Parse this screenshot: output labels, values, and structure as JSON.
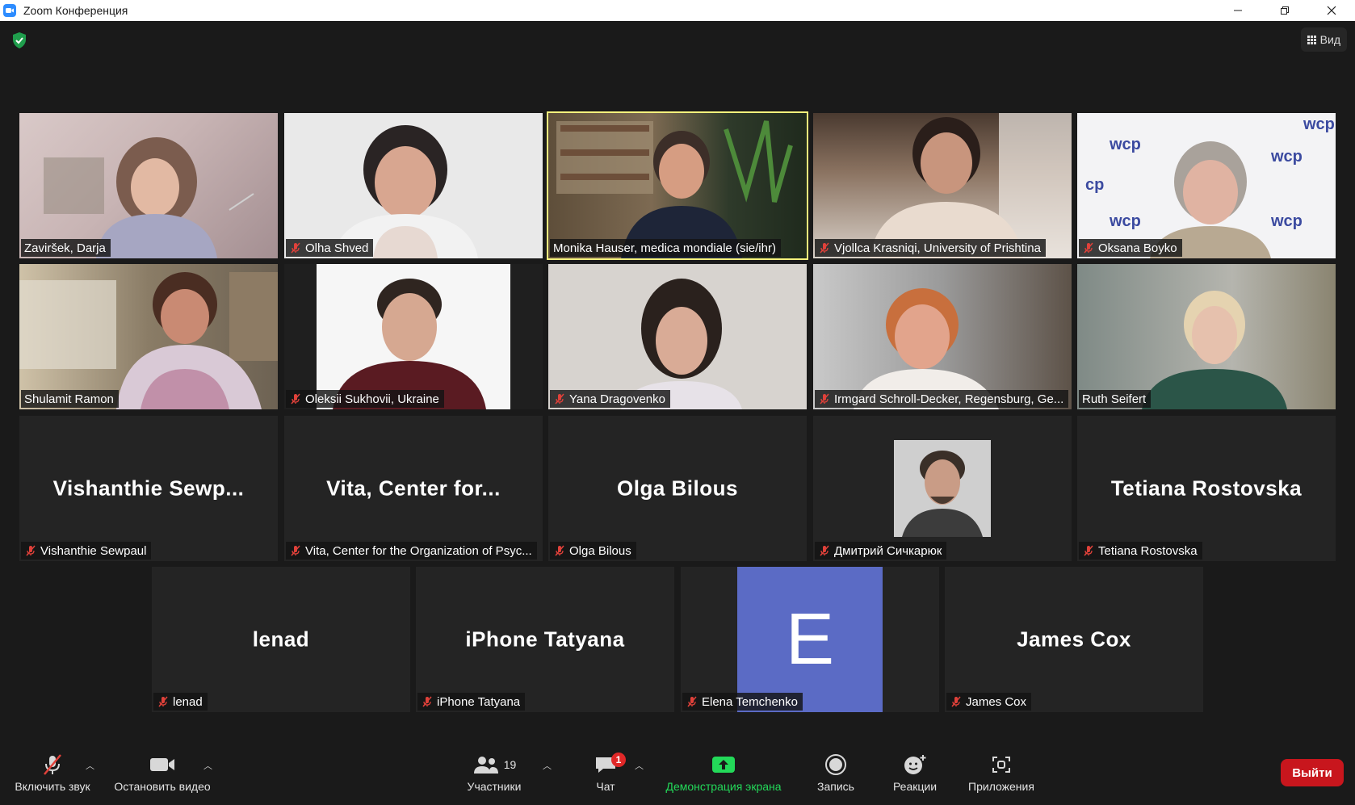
{
  "window": {
    "title": "Zoom Конференция",
    "controls": [
      "minimize",
      "maximize",
      "close"
    ]
  },
  "topbar": {
    "security_icon": "green-shield-check",
    "view_label": "Вид"
  },
  "participants": [
    {
      "name": "Zaviršek, Darja",
      "muted": false,
      "video": true,
      "active": false
    },
    {
      "name": "Olha Shved",
      "muted": true,
      "video": true,
      "active": false
    },
    {
      "name": "Monika Hauser, medica mondiale (sie/ihr)",
      "muted": false,
      "video": true,
      "active": true
    },
    {
      "name": "Vjollca Krasniqi, University of Prishtina",
      "muted": true,
      "video": true,
      "active": false
    },
    {
      "name": "Oksana Boyko",
      "muted": true,
      "video": true,
      "active": false
    },
    {
      "name": "Shulamit Ramon",
      "muted": false,
      "video": true,
      "active": false
    },
    {
      "name": "Oleksii Sukhovii, Ukraine",
      "muted": true,
      "video": true,
      "active": false
    },
    {
      "name": "Yana Dragovenko",
      "muted": true,
      "video": true,
      "active": false
    },
    {
      "name": "Irmgard Schroll-Decker, Regensburg, Ge...",
      "muted": true,
      "video": true,
      "active": false
    },
    {
      "name": "Ruth Seifert",
      "muted": false,
      "video": true,
      "active": false
    },
    {
      "name": "Vishanthie Sewpaul",
      "big": "Vishanthie  Sewp...",
      "muted": true,
      "video": false
    },
    {
      "name": "Vita, Center for the Organization of Psyc...",
      "big": "Vita,  Center  for...",
      "muted": true,
      "video": false
    },
    {
      "name": "Olga Bilous",
      "big": "Olga Bilous",
      "muted": true,
      "video": false
    },
    {
      "name": "Дмитрий Сичкарюк",
      "muted": true,
      "video": false,
      "avatar": true
    },
    {
      "name": "Tetiana Rostovska",
      "big": "Tetiana Rostovska",
      "muted": true,
      "video": false
    },
    {
      "name": "lenad",
      "big": "lenad",
      "muted": true,
      "video": false
    },
    {
      "name": "iPhone Tatyana",
      "big": "iPhone Tatyana",
      "muted": true,
      "video": false
    },
    {
      "name": "Elena Temchenko",
      "letter": "E",
      "muted": true,
      "video": false
    },
    {
      "name": "James Cox",
      "big": "James Cox",
      "muted": true,
      "video": false
    }
  ],
  "toolbar": {
    "unmute_label": "Включить звук",
    "stop_video_label": "Остановить видео",
    "participants_label": "Участники",
    "participants_count": "19",
    "chat_label": "Чат",
    "chat_badge": "1",
    "share_label": "Демонстрация экрана",
    "record_label": "Запись",
    "reactions_label": "Реакции",
    "apps_label": "Приложения",
    "leave_label": "Выйти"
  },
  "colors": {
    "background": "#1a1a1a",
    "tile": "#242424",
    "active_border": "#f6f27c",
    "share_green": "#23d959",
    "leave_red": "#c8161d",
    "mute_red": "#e0413a",
    "avatar_blue": "#5b6bc5"
  }
}
